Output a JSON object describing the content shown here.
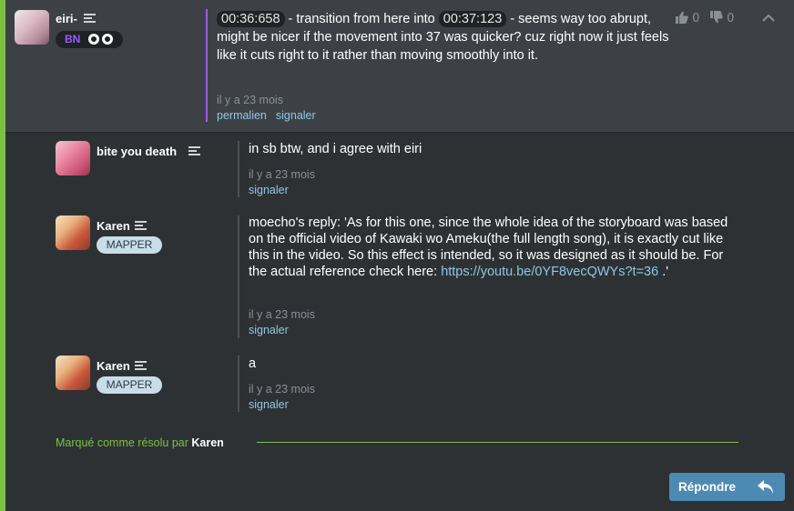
{
  "main_post": {
    "username": "eiri-",
    "badge": "BN",
    "timestamp_1": "00:36:658",
    "text_1": " - transition from here into ",
    "timestamp_2": "00:37:123",
    "text_2": " - seems way too abrupt, might be nicer if the movement into 37 was quicker? cuz right now it just feels like it cuts right to it rather than moving smoothly into it.",
    "time_ago": "il y a 23 mois",
    "permalink": "permalien",
    "report": "signaler",
    "upvotes": "0",
    "downvotes": "0"
  },
  "replies": [
    {
      "username": "bite you death",
      "text": "in sb btw, and i agree with eiri",
      "time_ago": "il y a 23 mois",
      "report": "signaler"
    },
    {
      "username": "Karen",
      "badge": "MAPPER",
      "text": "moecho's reply: 'As for this one, since the whole idea of the storyboard was based on the official video of Kawaki wo Ameku(the full length song), it is exactly cut like this in the video. So this effect is intended, so it was designed as it should be. For the actual reference check here: ",
      "link": "https://youtu.be/0YF8vecQWYs?t=36",
      "text_end": " .'",
      "time_ago": "il y a 23 mois",
      "report": "signaler"
    },
    {
      "username": "Karen",
      "badge": "MAPPER",
      "text": "a",
      "time_ago": "il y a 23 mois",
      "report": "signaler"
    }
  ],
  "resolved": {
    "label": "Marqué comme résolu par ",
    "by": "Karen"
  },
  "reply_button": "Répondre",
  "colors": {
    "accent_green": "#7bc043",
    "main_border_purple": "#a25ae8",
    "link_blue": "#8fc7e3",
    "reply_button": "#4d8ab3"
  },
  "icons": [
    "list-icon",
    "mode-icon",
    "thumbs-up-icon",
    "thumbs-down-icon",
    "chevron-up-icon",
    "reply-arrow-icon"
  ]
}
